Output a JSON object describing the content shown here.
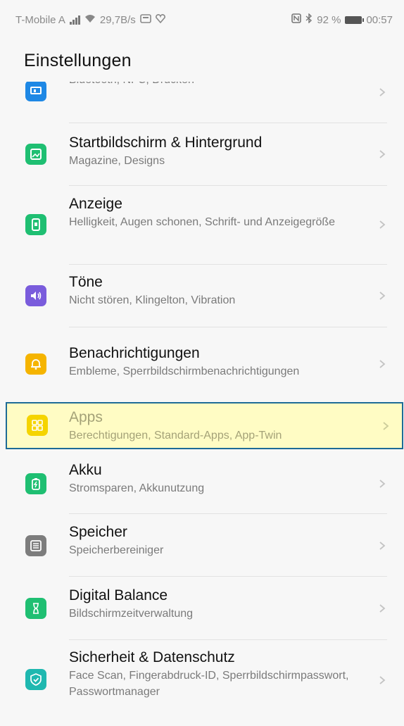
{
  "status_bar": {
    "carrier": "T-Mobile A",
    "speed": "29,7B/s",
    "battery": "92 %",
    "time": "00:57"
  },
  "header": {
    "title": "Einstellungen"
  },
  "settings": [
    {
      "title": "",
      "subtitle": "Bluetooth, NFC, Drucken",
      "icon": "devices-icon",
      "color": "#1e88e5"
    },
    {
      "title": "Startbildschirm & Hintergrund",
      "subtitle": "Magazine, Designs",
      "icon": "wallpaper-icon",
      "color": "#1fbf72"
    },
    {
      "title": "Anzeige",
      "subtitle": "Helligkeit, Augen schonen, Schrift- und Anzeigegröße",
      "icon": "display-icon",
      "color": "#1fbf72"
    },
    {
      "title": "Töne",
      "subtitle": "Nicht stören, Klingelton, Vibration",
      "icon": "speaker-icon",
      "color": "#7a5cdc"
    },
    {
      "title": "Benachrichtigungen",
      "subtitle": "Embleme, Sperrbildschirmbenachrichtigungen",
      "icon": "bell-icon",
      "color": "#f5b400"
    },
    {
      "title": "Apps",
      "subtitle": "Berechtigungen, Standard-Apps, App-Twin",
      "icon": "apps-grid-icon",
      "color": "#f5d400"
    },
    {
      "title": "Akku",
      "subtitle": "Stromsparen, Akkunutzung",
      "icon": "battery-icon",
      "color": "#1fbf72"
    },
    {
      "title": "Speicher",
      "subtitle": "Speicherbereiniger",
      "icon": "storage-icon",
      "color": "#7d7d7d"
    },
    {
      "title": "Digital Balance",
      "subtitle": "Bildschirmzeitverwaltung",
      "icon": "hourglass-icon",
      "color": "#1fbf72"
    },
    {
      "title": "Sicherheit & Datenschutz",
      "subtitle": "Face Scan, Fingerabdruck-ID, Sperrbildschirmpasswort, Passwortmanager",
      "icon": "shield-icon",
      "color": "#1fb8b0"
    }
  ]
}
